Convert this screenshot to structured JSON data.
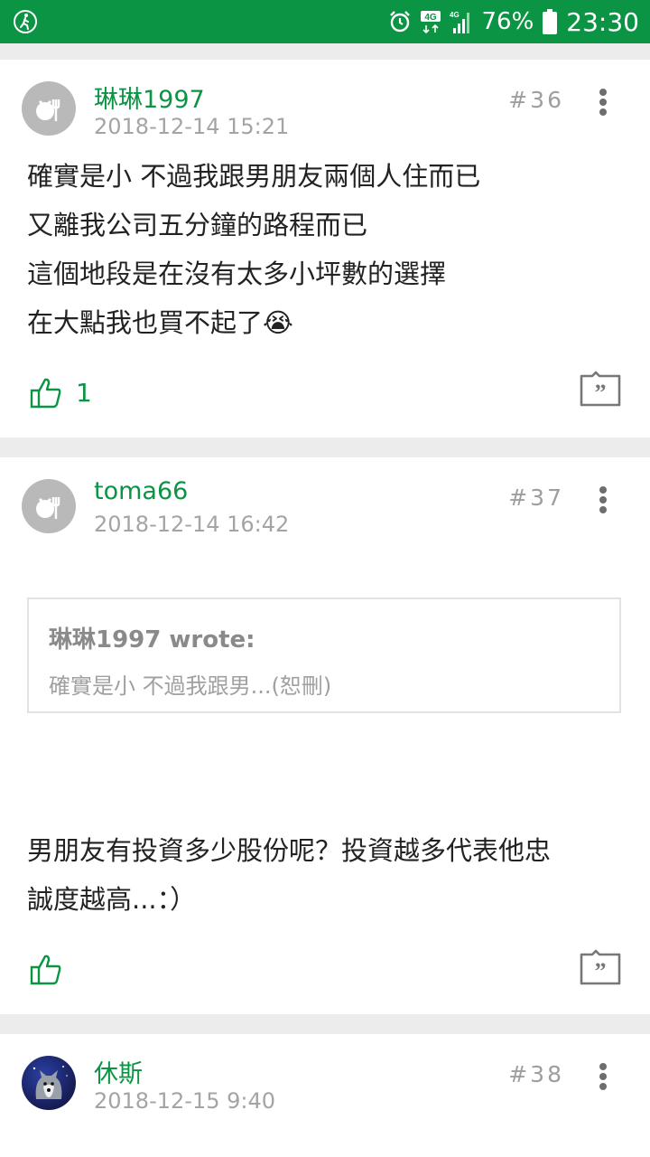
{
  "status_bar": {
    "icons": [
      "walk-icon",
      "alarm-icon",
      "4g-icon",
      "signal-icon",
      "battery-icon"
    ],
    "network_label": "4G",
    "battery_percent": "76%",
    "time": "23:30"
  },
  "colors": {
    "accent": "#0b9444",
    "timestamp": "#a4a4a4",
    "background": "#ececec"
  },
  "posts": [
    {
      "username": "琳琳1997",
      "timestamp": "2018-12-14 15:21",
      "floor": "#36",
      "avatar": "default-avatar-icon",
      "lines": [
        "確實是小 不過我跟男朋友兩個人住而已",
        "又離我公司五分鐘的路程而已",
        "這個地段是在沒有太多小坪數的選擇",
        "在大點我也買不起了😭"
      ],
      "like_count": "1"
    },
    {
      "username": "toma66",
      "timestamp": "2018-12-14 16:42",
      "floor": "#37",
      "avatar": "default-avatar-icon",
      "quote": {
        "author": "琳琳1997 wrote:",
        "text": "確實是小 不過我跟男...(恕刪)"
      },
      "lines": [
        "男朋友有投資多少股份呢？投資越多代表他忠",
        "誠度越高...：）"
      ],
      "like_count": ""
    },
    {
      "username": "休斯",
      "timestamp": "2018-12-15 9:40",
      "floor": "#38",
      "avatar": "husky-photo-avatar"
    }
  ]
}
